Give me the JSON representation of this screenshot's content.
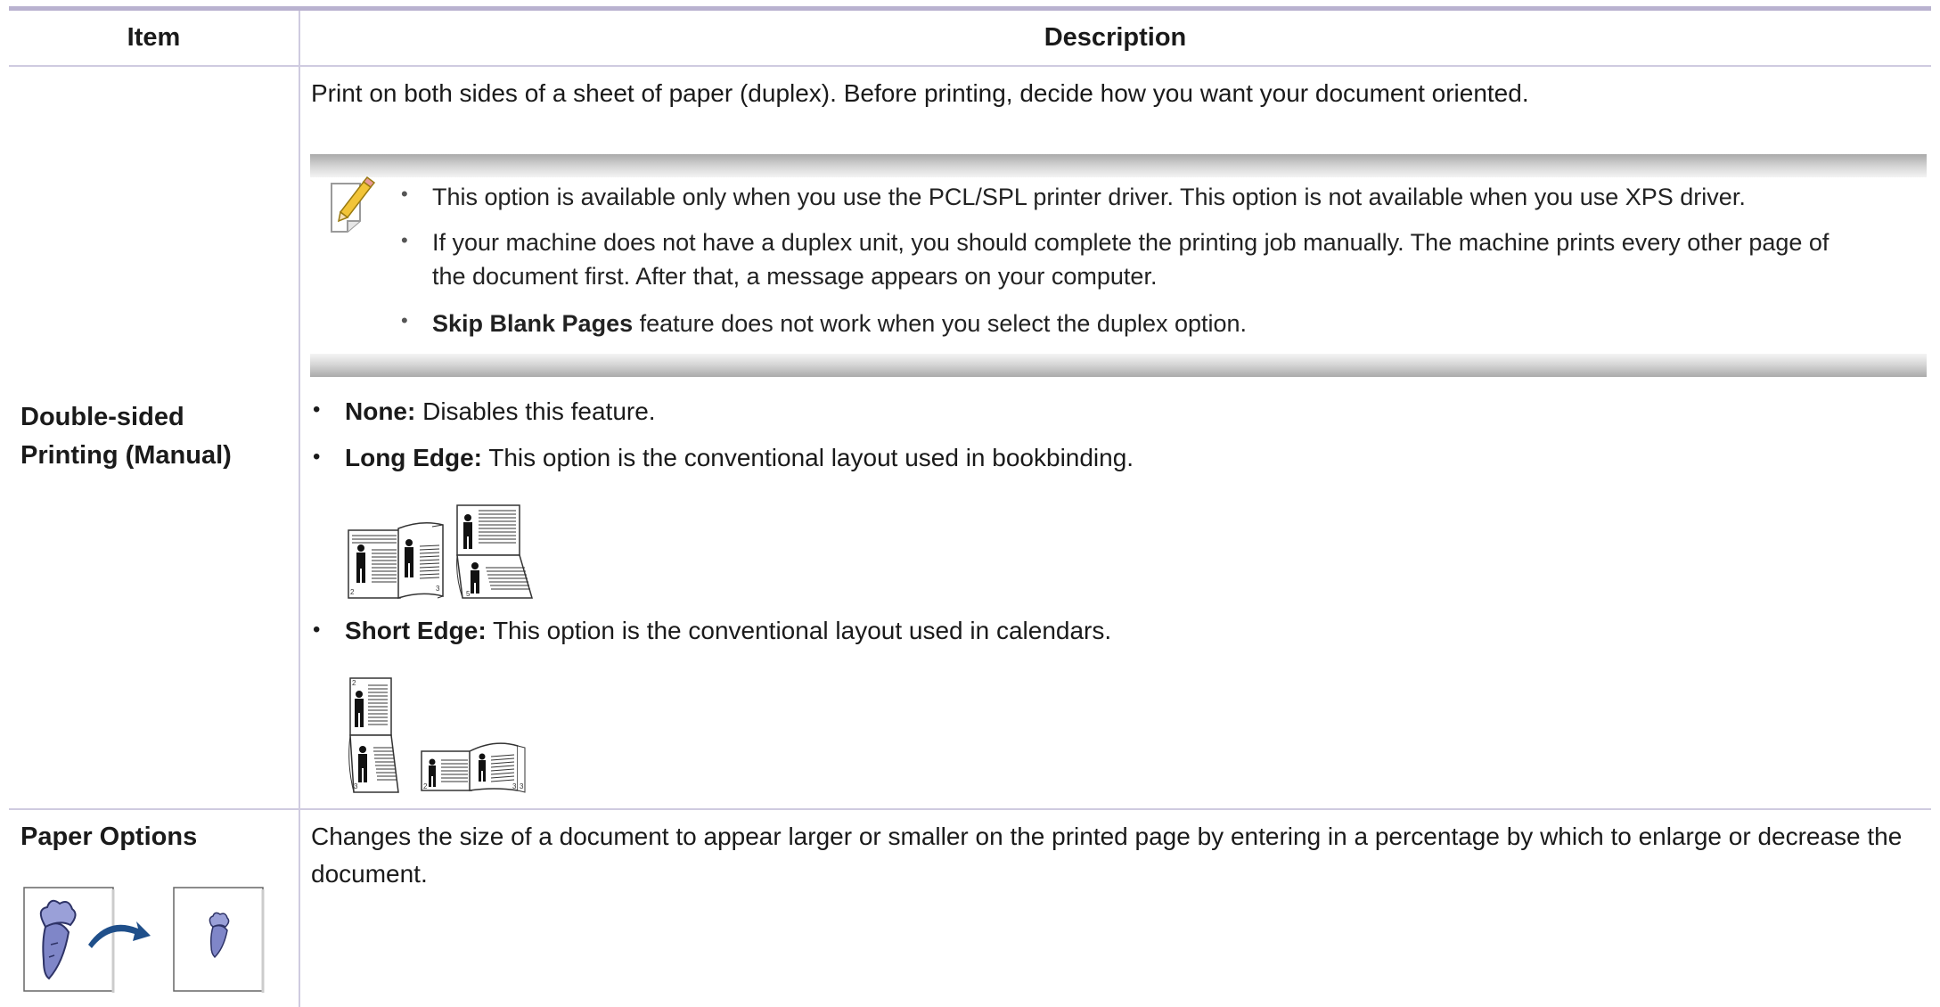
{
  "table": {
    "headers": {
      "item": "Item",
      "description": "Description"
    },
    "rows": [
      {
        "item_line1": "Double-sided",
        "item_line2": "Printing (Manual)",
        "intro": "Print on both sides of a sheet of paper (duplex). Before printing, decide how you want your document oriented.",
        "notes": [
          "This option is available only when you use the PCL/SPL printer driver. This option is not available when you use XPS driver.",
          "If your machine does not have a duplex unit, you should complete the printing job manually. The machine prints every other page of",
          "the document first. After that, a message appears on your computer.",
          "feature does not work when you select the duplex option."
        ],
        "note_bold": "Skip Blank Pages",
        "options": [
          {
            "label": "None:",
            "text": " Disables this feature."
          },
          {
            "label": "Long Edge:",
            "text": " This option is the conventional layout used in bookbinding."
          },
          {
            "label": "Short Edge:",
            "text": " This option is the conventional layout used in calendars."
          }
        ],
        "page_numbers": [
          "2",
          "3",
          "5",
          "2",
          "3",
          "2",
          "3",
          "3"
        ]
      },
      {
        "item": "Paper Options",
        "description_line1": "Changes the size of a document to appear larger or smaller on the printed page by entering in a percentage by which to enlarge or decrease the",
        "description_line2": "document."
      }
    ]
  },
  "icons": {
    "note": "note-pencil-icon",
    "bullet": "•"
  },
  "colors": {
    "rule": "#b9b2d0",
    "grid": "#cfcbe0",
    "carrot": "#7f86c8",
    "arrow": "#1f4f8a"
  }
}
